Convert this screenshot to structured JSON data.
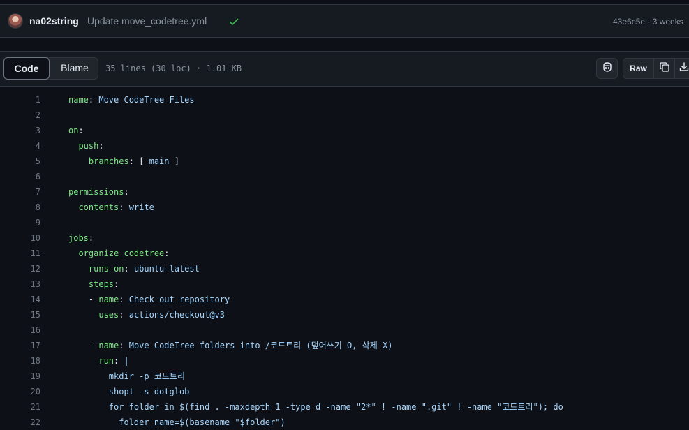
{
  "commit": {
    "author": "na02string",
    "message": "Update move_codetree.yml",
    "status_icon": "check-icon",
    "sha_time": "43e6c5e · 3 weeks"
  },
  "toolbar": {
    "code_tab": "Code",
    "blame_tab": "Blame",
    "file_info": "35 lines (30 loc) · 1.01 KB",
    "raw_label": "Raw",
    "icons": [
      "copilot-icon",
      "copy-icon",
      "download-icon"
    ]
  },
  "colors": {
    "background": "#0d1117",
    "yaml_key": "#7ee787",
    "yaml_value": "#a5d6ff",
    "line_number": "#6e7681"
  },
  "code_lines": [
    {
      "n": "1",
      "indent": "",
      "key": "name",
      "sep": ": ",
      "val": "Move CodeTree Files"
    },
    {
      "n": "2",
      "indent": "",
      "key": "",
      "sep": "",
      "val": ""
    },
    {
      "n": "3",
      "indent": "",
      "key": "on",
      "sep": ":",
      "val": ""
    },
    {
      "n": "4",
      "indent": "  ",
      "key": "push",
      "sep": ":",
      "val": ""
    },
    {
      "n": "5",
      "indent": "    ",
      "key": "branches",
      "sep": ": [ ",
      "val": "main"
    },
    {
      "n": "6",
      "indent": "",
      "key": "",
      "sep": "",
      "val": ""
    },
    {
      "n": "7",
      "indent": "",
      "key": "permissions",
      "sep": ":",
      "val": ""
    },
    {
      "n": "8",
      "indent": "  ",
      "key": "contents",
      "sep": ": ",
      "val": "write"
    },
    {
      "n": "9",
      "indent": "",
      "key": "",
      "sep": "",
      "val": ""
    },
    {
      "n": "10",
      "indent": "",
      "key": "jobs",
      "sep": ":",
      "val": ""
    },
    {
      "n": "11",
      "indent": "  ",
      "key": "organize_codetree",
      "sep": ":",
      "val": ""
    },
    {
      "n": "12",
      "indent": "    ",
      "key": "runs-on",
      "sep": ": ",
      "val": "ubuntu-latest"
    },
    {
      "n": "13",
      "indent": "    ",
      "key": "steps",
      "sep": ":",
      "val": ""
    },
    {
      "n": "14",
      "indent": "    - ",
      "key": "name",
      "sep": ": ",
      "val": "Check out repository"
    },
    {
      "n": "15",
      "indent": "      ",
      "key": "uses",
      "sep": ": ",
      "val": "actions/checkout@v3"
    },
    {
      "n": "16",
      "indent": "",
      "key": "",
      "sep": "",
      "val": ""
    },
    {
      "n": "17",
      "indent": "    - ",
      "key": "name",
      "sep": ": ",
      "val": "Move CodeTree folders into /코드트리 (덮어쓰기 O, 삭제 X)"
    },
    {
      "n": "18",
      "indent": "      ",
      "key": "run",
      "sep": ": ",
      "val": "|"
    },
    {
      "n": "19",
      "indent": "        ",
      "key": "",
      "sep": "",
      "val": "mkdir -p 코드트리"
    },
    {
      "n": "20",
      "indent": "        ",
      "key": "",
      "sep": "",
      "val": "shopt -s dotglob"
    },
    {
      "n": "21",
      "indent": "        ",
      "key": "",
      "sep": "",
      "val": "for folder in $(find . -maxdepth 1 -type d -name \"2*\" ! -name \".git\" ! -name \"코드트리\"); do"
    },
    {
      "n": "22",
      "indent": "          ",
      "key": "",
      "sep": "",
      "val": "folder_name=$(basename \"$folder\")"
    }
  ]
}
